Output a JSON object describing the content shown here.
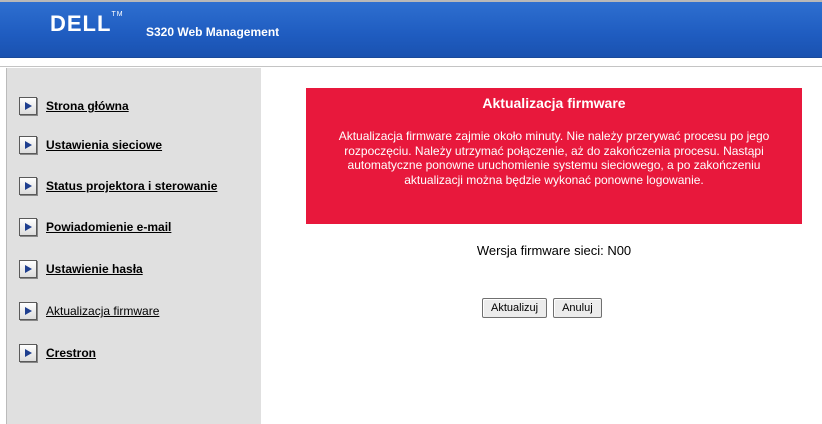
{
  "header": {
    "logo_text": "DELL",
    "logo_tm": "TM",
    "title": "S320 Web Management"
  },
  "sidebar": {
    "items": [
      {
        "label": "Strona główna",
        "active": false
      },
      {
        "label": "Ustawienia sieciowe",
        "active": false
      },
      {
        "label": "Status projektora i sterowanie",
        "active": false
      },
      {
        "label": "Powiadomienie e-mail",
        "active": false
      },
      {
        "label": "Ustawienie hasła",
        "active": false
      },
      {
        "label": "Aktualizacja firmware",
        "active": true
      },
      {
        "label": "Crestron",
        "active": false
      }
    ]
  },
  "main": {
    "warning_title": "Aktualizacja firmware",
    "warning_text": "Aktualizacja firmware zajmie około minuty. Nie należy przerywać procesu po jego rozpoczęciu. Należy utrzymać połączenie, aż do zakończenia procesu. Nastąpi automatyczne ponowne uruchomienie systemu sieciowego, a po zakończeniu aktualizacji można będzie wykonać ponowne logowanie.",
    "firmware_version": "Wersja firmware sieci: N00",
    "update_button": "Aktualizuj",
    "cancel_button": "Anuluj"
  },
  "colors": {
    "header_blue": "#1f5cc0",
    "sidebar_gray": "#e0e0e0",
    "warning_red": "#e8183c"
  },
  "icons": {
    "nav_arrow": "play-arrow-icon"
  }
}
